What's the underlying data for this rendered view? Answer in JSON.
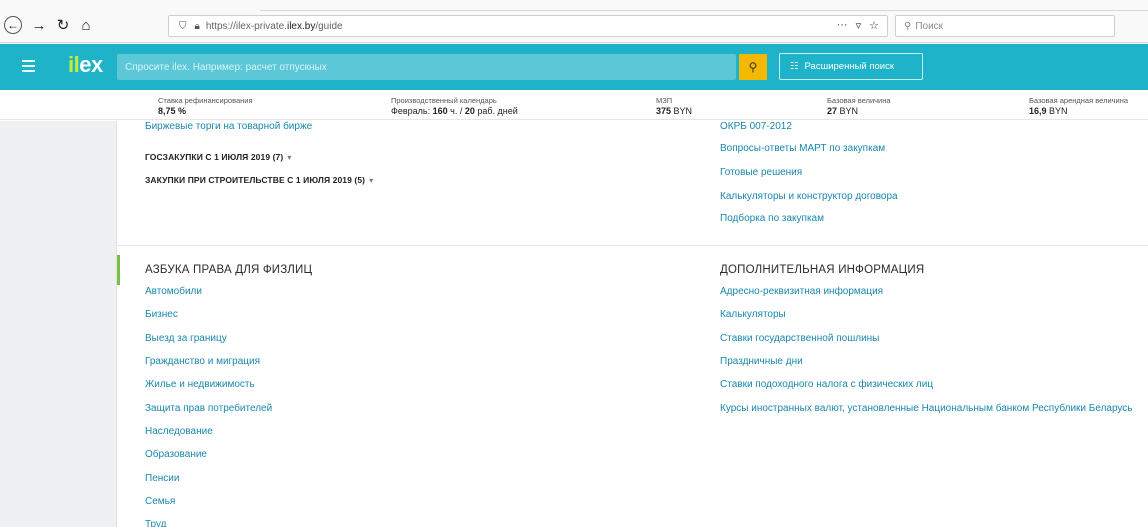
{
  "browser": {
    "url_prefix": "https://ilex-private.",
    "url_domain": "ilex.by",
    "url_path": "/guide",
    "search_placeholder": "Поиск",
    "tools": "··· ☆"
  },
  "app": {
    "logo_i": "il",
    "logo_rest": "ex",
    "search_placeholder": "Спросите ilex. Например: расчет отпускных",
    "advanced_search_label": "Расширенный поиск"
  },
  "info_strip": [
    {
      "label": "Ставка рефинансирования",
      "value": "8,75 %"
    },
    {
      "label": "Производственный календарь",
      "value_prefix": "Февраль: ",
      "value_bold1": "160",
      "value_mid": " ч. / ",
      "value_bold2": "20",
      "value_suffix": " раб. дней"
    },
    {
      "label": "МЗП",
      "value_bold": "375",
      "value_suffix": " BYN"
    },
    {
      "label": "Базовая величина",
      "value_bold": "27",
      "value_suffix": " BYN"
    },
    {
      "label": "Базовая арендная величина",
      "value_bold": "16,9",
      "value_suffix": " BYN"
    }
  ],
  "top_left": {
    "link_top": "Биржевые торги на товарной бирже",
    "group1": "ГОСЗАКУПКИ С 1 ИЮЛЯ 2019 (7)",
    "group2": "ЗАКУПКИ ПРИ СТРОИТЕЛЬСТВЕ С 1 ИЮЛЯ 2019 (5)"
  },
  "top_right": {
    "links": [
      "ОКРБ 007-2012",
      "Вопросы-ответы МАРТ по закупкам",
      "Готовые решения",
      "Калькуляторы и конструктор договора",
      "Подборка по закупкам"
    ]
  },
  "section_left": {
    "title": "АЗБУКА ПРАВА ДЛЯ ФИЗЛИЦ",
    "links": [
      "Автомобили",
      "Бизнес",
      "Выезд за границу",
      "Гражданство и миграция",
      "Жилье и недвижимость",
      "Защита прав потребителей",
      "Наследование",
      "Образование",
      "Пенсии",
      "Семья",
      "Труд"
    ]
  },
  "section_right": {
    "title": "ДОПОЛНИТЕЛЬНАЯ ИНФОРМАЦИЯ",
    "links": [
      "Адресно-реквизитная информация",
      "Калькуляторы",
      "Ставки государственной пошлины",
      "Праздничные дни",
      "Ставки подоходного налога с физических лиц",
      "Курсы иностранных валют, установленные Национальным банком Республики Беларусь"
    ]
  },
  "colors": {
    "header": "#1eb3c9",
    "link": "#1a87ad",
    "accent_green": "#7bc043",
    "search_button": "#f5b800"
  }
}
